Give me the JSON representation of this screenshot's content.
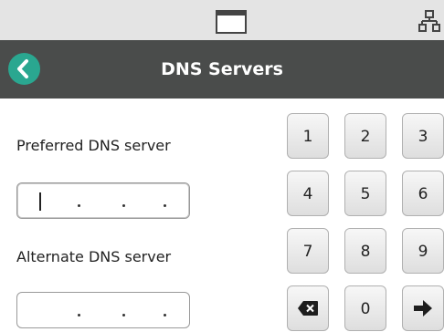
{
  "header": {
    "title": "DNS Servers"
  },
  "fields": {
    "preferred_label": "Preferred DNS server",
    "alternate_label": "Alternate DNS server"
  },
  "keypad": {
    "keys": [
      "1",
      "2",
      "3",
      "4",
      "5",
      "6",
      "7",
      "8",
      "9",
      "0"
    ]
  },
  "icons": {
    "status": [
      "window-icon",
      "network-icon"
    ],
    "header": "back-arrow-icon",
    "keypad": [
      "backspace-icon",
      "right-arrow-icon"
    ]
  },
  "colors": {
    "status_bar": "#e4e4e4",
    "header_bar": "#4a4c4b",
    "accent": "#2aa790",
    "key_face": "#eaeaea"
  }
}
